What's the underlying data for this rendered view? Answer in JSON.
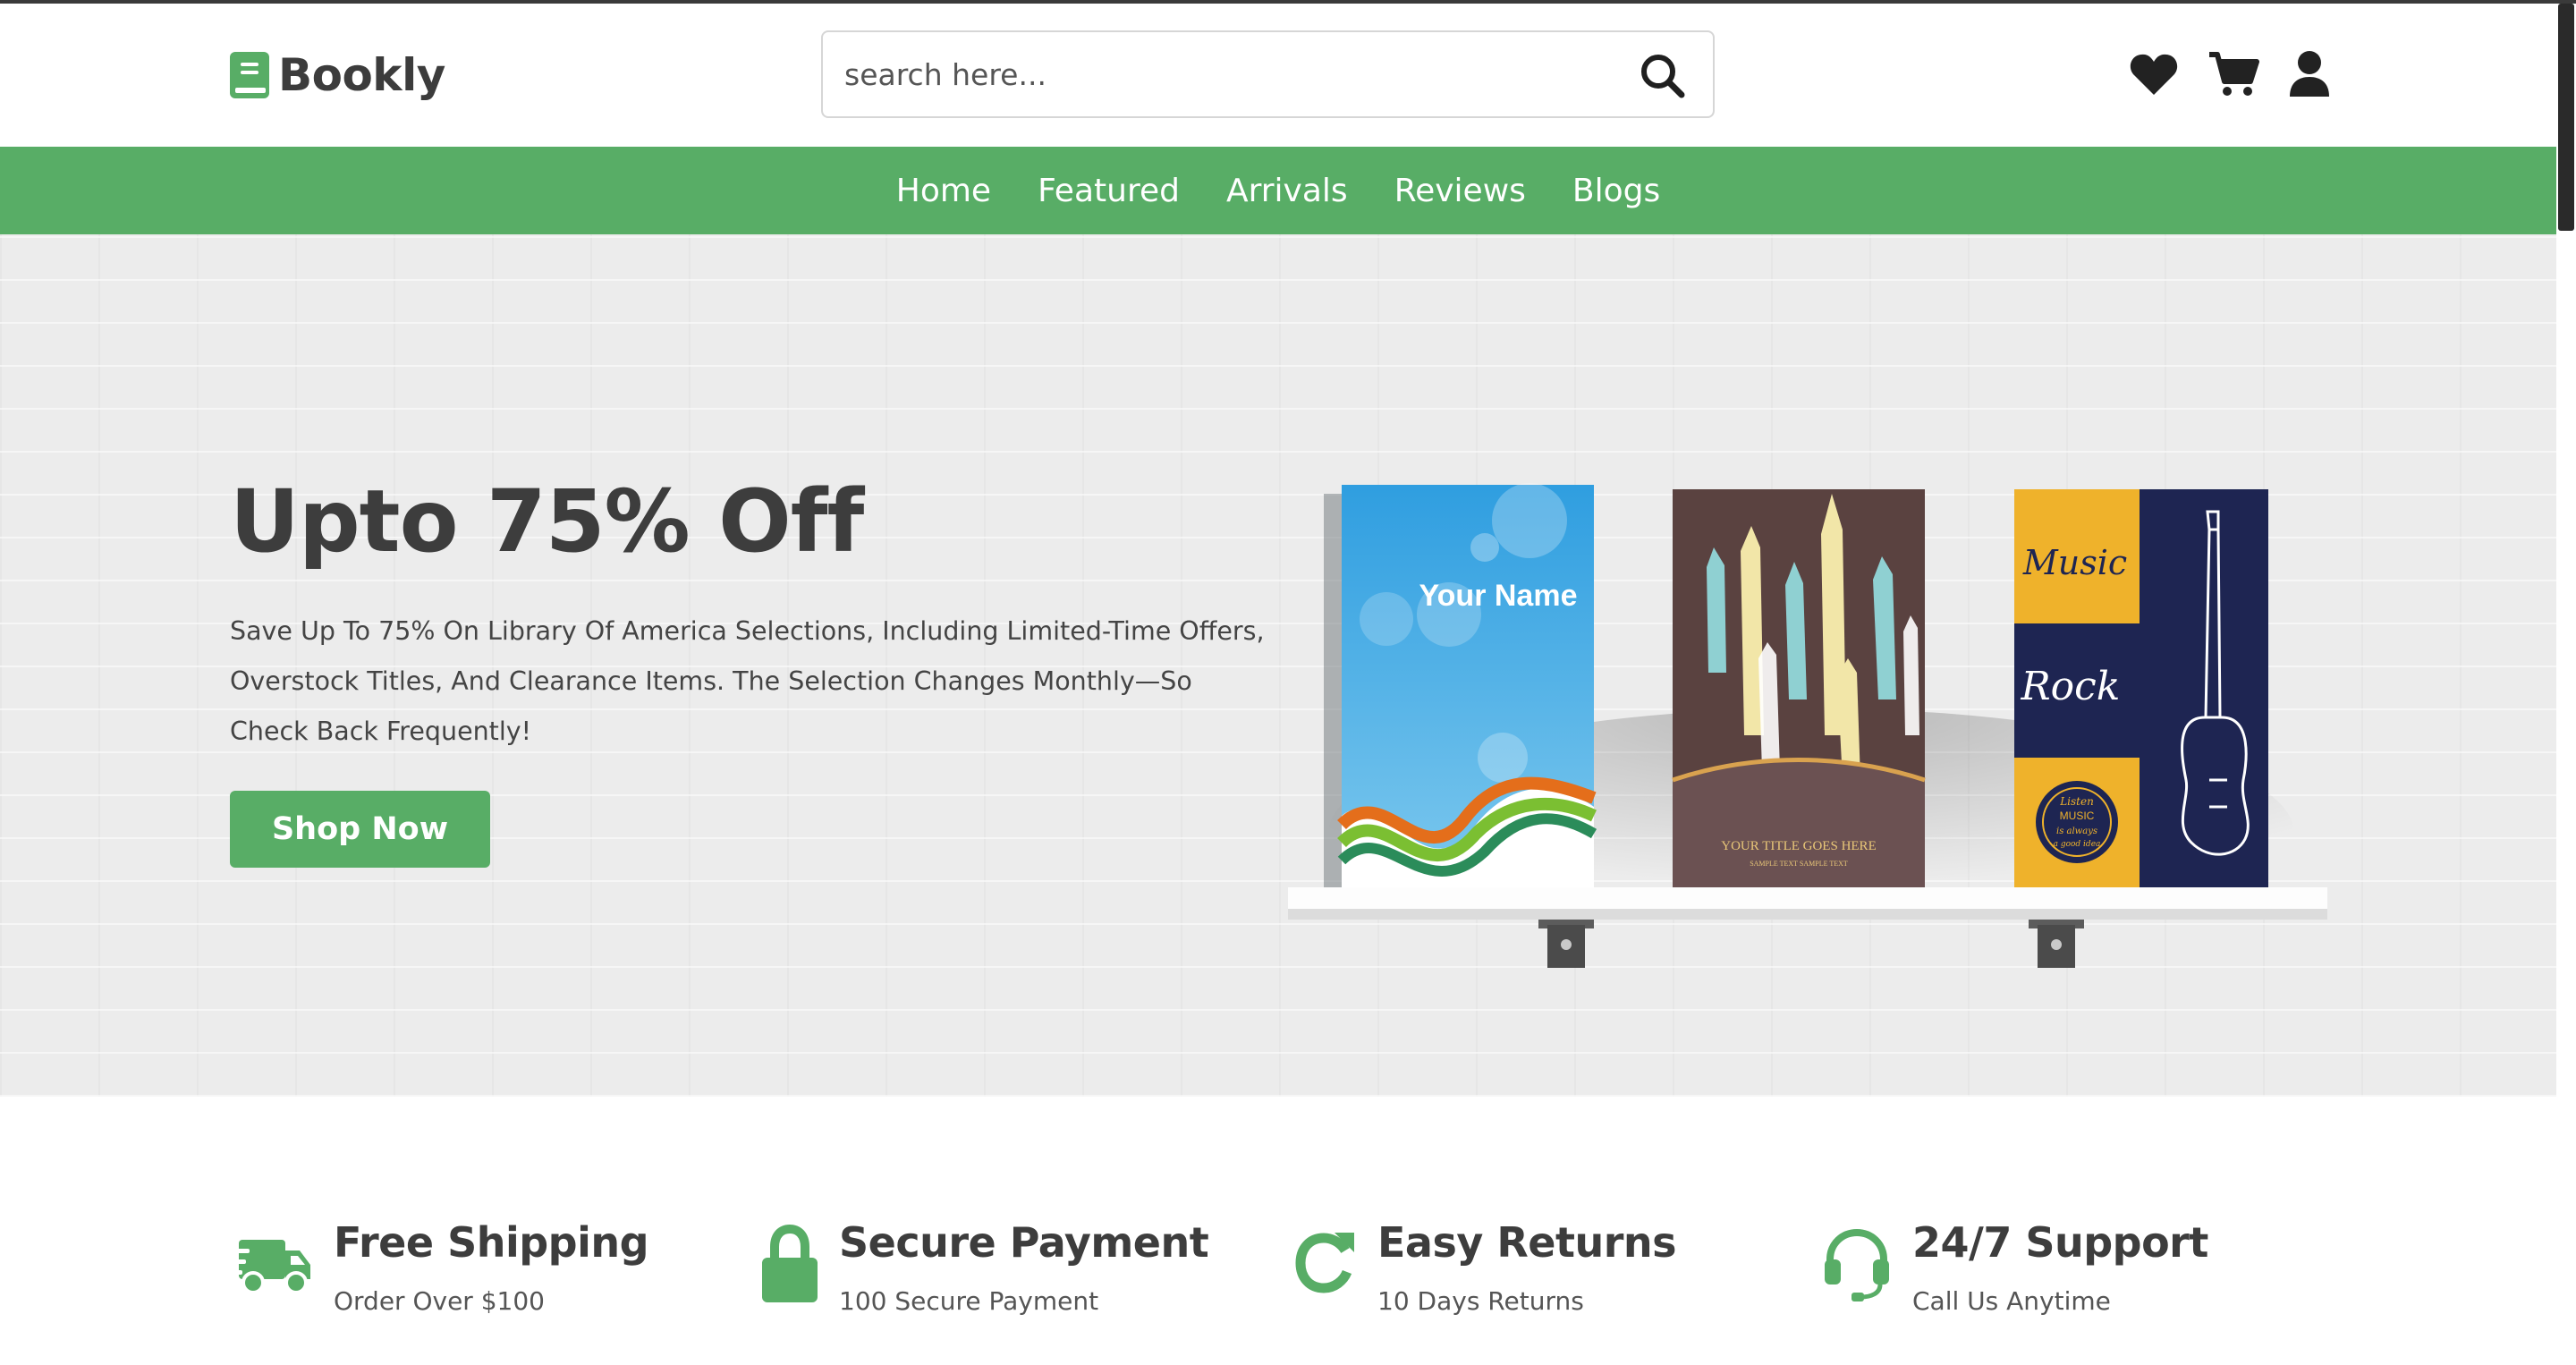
{
  "brand": {
    "name": "Bookly",
    "accent": "#58ad66"
  },
  "search": {
    "placeholder": "search here..."
  },
  "header_icons": [
    "heart-icon",
    "cart-icon",
    "user-icon"
  ],
  "nav": {
    "items": [
      "Home",
      "Featured",
      "Arrivals",
      "Reviews",
      "Blogs"
    ]
  },
  "hero": {
    "title": "Upto 75% Off",
    "text": "Save Up To 75% On Library Of America Selections, Including Limited-Time Offers, Overstock Titles, And Clearance Items. The Selection Changes Monthly—So Check Back Frequently!",
    "button": "Shop Now",
    "books": [
      {
        "cover_text": "Your Name"
      },
      {
        "cover_text": "YOUR TITLE GOES HERE",
        "cover_subtext": "SAMPLE TEXT SAMPLE TEXT"
      },
      {
        "cover_text": "Music",
        "cover_text_2": "Rock",
        "badge_lines": [
          "Listen",
          "MUSIC",
          "is always",
          "a good idea"
        ]
      }
    ]
  },
  "features": [
    {
      "icon": "truck-icon",
      "title": "Free Shipping",
      "subtitle": "Order Over $100"
    },
    {
      "icon": "lock-icon",
      "title": "Secure Payment",
      "subtitle": "100 Secure Payment"
    },
    {
      "icon": "redo-icon",
      "title": "Easy Returns",
      "subtitle": "10 Days Returns"
    },
    {
      "icon": "headset-icon",
      "title": "24/7 Support",
      "subtitle": "Call Us Anytime"
    }
  ]
}
